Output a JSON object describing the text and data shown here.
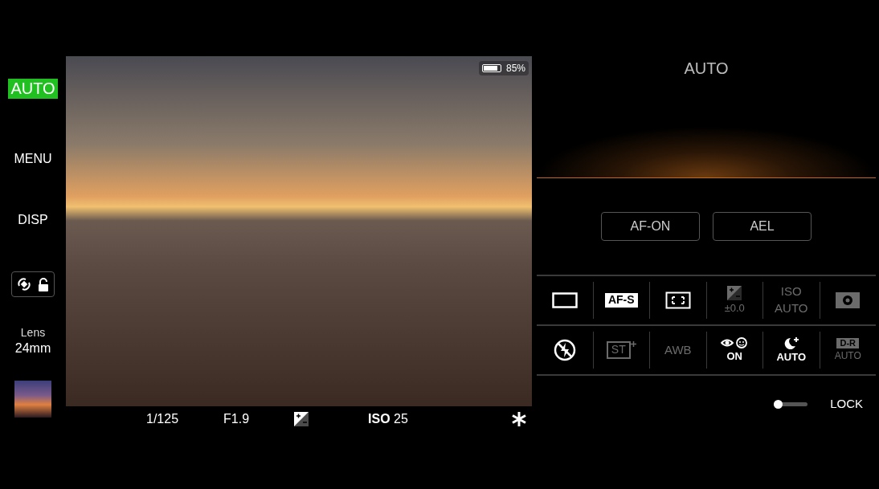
{
  "sidebar": {
    "mode_badge": "AUTO",
    "items": [
      {
        "kind": "text",
        "label": "MENU"
      },
      {
        "kind": "text",
        "label": "DISP"
      },
      {
        "kind": "stabilizer-lock",
        "locked": false
      },
      {
        "kind": "lens",
        "label": "Lens",
        "value": "24mm"
      },
      {
        "kind": "thumbnail"
      }
    ]
  },
  "viewfinder": {
    "battery": {
      "level": 0.85,
      "reading": "85%"
    },
    "status_bar": [
      {
        "kind": "text",
        "text": "1/125"
      },
      {
        "kind": "text",
        "text": "F1.9"
      },
      {
        "kind": "exposure-icon"
      },
      {
        "kind": "text",
        "text": "**ISO** 25"
      },
      {
        "kind": "ae-lock-icon"
      }
    ]
  },
  "panel": {
    "mode": "AUTO",
    "buttons": [
      "AF-ON",
      "AEL"
    ],
    "settings": [
      [
        {
          "kind": "drive",
          "disabled": false
        },
        {
          "kind": "focus-mode",
          "lines": [
            "AF-S"
          ],
          "disabled": false
        },
        {
          "kind": "focus-area",
          "disabled": false
        },
        {
          "kind": "exposure",
          "lines": [
            "±0.0"
          ],
          "disabled": true
        },
        {
          "kind": "text",
          "lines": [
            "ISO",
            "AUTO"
          ],
          "disabled": true
        },
        {
          "kind": "metering",
          "disabled": true
        }
      ],
      [
        {
          "kind": "flash-off",
          "disabled": false
        },
        {
          "kind": "style",
          "lines": [
            "ST"
          ],
          "disabled": true
        },
        {
          "kind": "text",
          "lines": [
            "AWB"
          ],
          "disabled": true
        },
        {
          "kind": "face-eye",
          "lines": [
            "ON"
          ],
          "disabled": false
        },
        {
          "kind": "night",
          "lines": [
            "AUTO"
          ],
          "disabled": false
        },
        {
          "kind": "dro",
          "lines": [
            "D-R",
            "AUTO"
          ],
          "disabled": true
        }
      ]
    ],
    "lock": {
      "label": "LOCK",
      "level": 0
    }
  }
}
